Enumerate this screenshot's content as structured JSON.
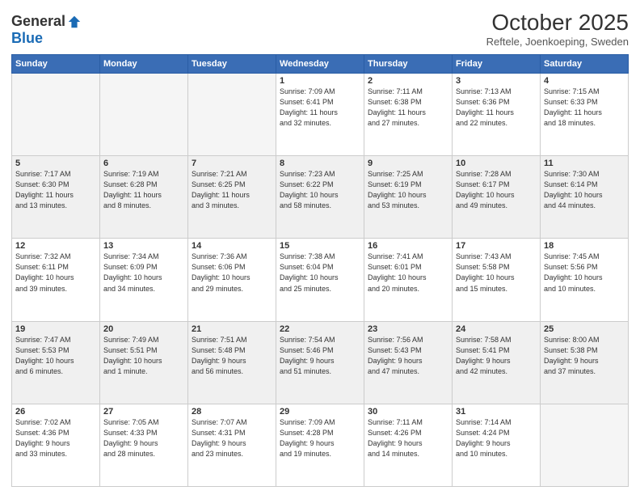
{
  "logo": {
    "general": "General",
    "blue": "Blue"
  },
  "header": {
    "month": "October 2025",
    "location": "Reftele, Joenkoeping, Sweden"
  },
  "weekdays": [
    "Sunday",
    "Monday",
    "Tuesday",
    "Wednesday",
    "Thursday",
    "Friday",
    "Saturday"
  ],
  "weeks": [
    [
      {
        "day": "",
        "info": ""
      },
      {
        "day": "",
        "info": ""
      },
      {
        "day": "",
        "info": ""
      },
      {
        "day": "1",
        "info": "Sunrise: 7:09 AM\nSunset: 6:41 PM\nDaylight: 11 hours\nand 32 minutes."
      },
      {
        "day": "2",
        "info": "Sunrise: 7:11 AM\nSunset: 6:38 PM\nDaylight: 11 hours\nand 27 minutes."
      },
      {
        "day": "3",
        "info": "Sunrise: 7:13 AM\nSunset: 6:36 PM\nDaylight: 11 hours\nand 22 minutes."
      },
      {
        "day": "4",
        "info": "Sunrise: 7:15 AM\nSunset: 6:33 PM\nDaylight: 11 hours\nand 18 minutes."
      }
    ],
    [
      {
        "day": "5",
        "info": "Sunrise: 7:17 AM\nSunset: 6:30 PM\nDaylight: 11 hours\nand 13 minutes."
      },
      {
        "day": "6",
        "info": "Sunrise: 7:19 AM\nSunset: 6:28 PM\nDaylight: 11 hours\nand 8 minutes."
      },
      {
        "day": "7",
        "info": "Sunrise: 7:21 AM\nSunset: 6:25 PM\nDaylight: 11 hours\nand 3 minutes."
      },
      {
        "day": "8",
        "info": "Sunrise: 7:23 AM\nSunset: 6:22 PM\nDaylight: 10 hours\nand 58 minutes."
      },
      {
        "day": "9",
        "info": "Sunrise: 7:25 AM\nSunset: 6:19 PM\nDaylight: 10 hours\nand 53 minutes."
      },
      {
        "day": "10",
        "info": "Sunrise: 7:28 AM\nSunset: 6:17 PM\nDaylight: 10 hours\nand 49 minutes."
      },
      {
        "day": "11",
        "info": "Sunrise: 7:30 AM\nSunset: 6:14 PM\nDaylight: 10 hours\nand 44 minutes."
      }
    ],
    [
      {
        "day": "12",
        "info": "Sunrise: 7:32 AM\nSunset: 6:11 PM\nDaylight: 10 hours\nand 39 minutes."
      },
      {
        "day": "13",
        "info": "Sunrise: 7:34 AM\nSunset: 6:09 PM\nDaylight: 10 hours\nand 34 minutes."
      },
      {
        "day": "14",
        "info": "Sunrise: 7:36 AM\nSunset: 6:06 PM\nDaylight: 10 hours\nand 29 minutes."
      },
      {
        "day": "15",
        "info": "Sunrise: 7:38 AM\nSunset: 6:04 PM\nDaylight: 10 hours\nand 25 minutes."
      },
      {
        "day": "16",
        "info": "Sunrise: 7:41 AM\nSunset: 6:01 PM\nDaylight: 10 hours\nand 20 minutes."
      },
      {
        "day": "17",
        "info": "Sunrise: 7:43 AM\nSunset: 5:58 PM\nDaylight: 10 hours\nand 15 minutes."
      },
      {
        "day": "18",
        "info": "Sunrise: 7:45 AM\nSunset: 5:56 PM\nDaylight: 10 hours\nand 10 minutes."
      }
    ],
    [
      {
        "day": "19",
        "info": "Sunrise: 7:47 AM\nSunset: 5:53 PM\nDaylight: 10 hours\nand 6 minutes."
      },
      {
        "day": "20",
        "info": "Sunrise: 7:49 AM\nSunset: 5:51 PM\nDaylight: 10 hours\nand 1 minute."
      },
      {
        "day": "21",
        "info": "Sunrise: 7:51 AM\nSunset: 5:48 PM\nDaylight: 9 hours\nand 56 minutes."
      },
      {
        "day": "22",
        "info": "Sunrise: 7:54 AM\nSunset: 5:46 PM\nDaylight: 9 hours\nand 51 minutes."
      },
      {
        "day": "23",
        "info": "Sunrise: 7:56 AM\nSunset: 5:43 PM\nDaylight: 9 hours\nand 47 minutes."
      },
      {
        "day": "24",
        "info": "Sunrise: 7:58 AM\nSunset: 5:41 PM\nDaylight: 9 hours\nand 42 minutes."
      },
      {
        "day": "25",
        "info": "Sunrise: 8:00 AM\nSunset: 5:38 PM\nDaylight: 9 hours\nand 37 minutes."
      }
    ],
    [
      {
        "day": "26",
        "info": "Sunrise: 7:02 AM\nSunset: 4:36 PM\nDaylight: 9 hours\nand 33 minutes."
      },
      {
        "day": "27",
        "info": "Sunrise: 7:05 AM\nSunset: 4:33 PM\nDaylight: 9 hours\nand 28 minutes."
      },
      {
        "day": "28",
        "info": "Sunrise: 7:07 AM\nSunset: 4:31 PM\nDaylight: 9 hours\nand 23 minutes."
      },
      {
        "day": "29",
        "info": "Sunrise: 7:09 AM\nSunset: 4:28 PM\nDaylight: 9 hours\nand 19 minutes."
      },
      {
        "day": "30",
        "info": "Sunrise: 7:11 AM\nSunset: 4:26 PM\nDaylight: 9 hours\nand 14 minutes."
      },
      {
        "day": "31",
        "info": "Sunrise: 7:14 AM\nSunset: 4:24 PM\nDaylight: 9 hours\nand 10 minutes."
      },
      {
        "day": "",
        "info": ""
      }
    ]
  ]
}
